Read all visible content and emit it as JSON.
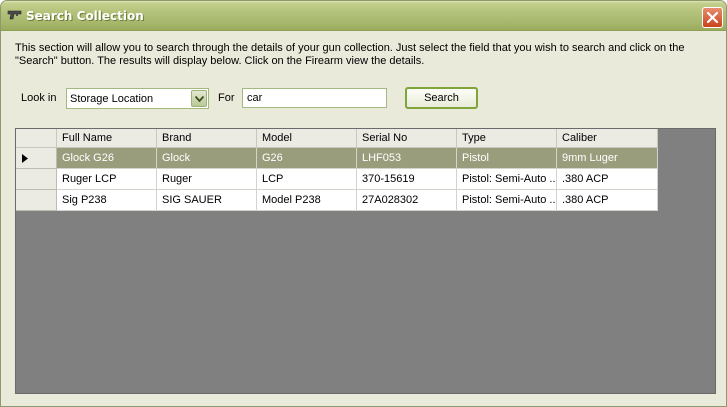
{
  "window": {
    "title": "Search Collection",
    "icon": "gun-icon"
  },
  "description": "This section will allow you to search through the details of your gun collection.  Just select the field that you wish to search and click on the \"Search\" button.  The results will display below.  Click on the Firearm view the details.",
  "search": {
    "look_in_label": "Look in",
    "look_in_value": "Storage Location",
    "for_label": "For",
    "query": "car",
    "button_label": "Search"
  },
  "grid": {
    "columns": [
      "Full Name",
      "Brand",
      "Model",
      "Serial No",
      "Type",
      "Caliber"
    ],
    "rows": [
      {
        "full_name": "Glock G26",
        "brand": "Glock",
        "model": "G26",
        "serial": "LHF053",
        "type": "Pistol",
        "caliber": "9mm Luger",
        "selected": true
      },
      {
        "full_name": "Ruger LCP",
        "brand": "Ruger",
        "model": "LCP",
        "serial": "370-15619",
        "type": "Pistol: Semi-Auto ...",
        "caliber": ".380 ACP",
        "selected": false
      },
      {
        "full_name": "Sig P238",
        "brand": "SIG SAUER",
        "model": "Model P238",
        "serial": "27A028302",
        "type": "Pistol: Semi-Auto ...",
        "caliber": ".380 ACP",
        "selected": false
      }
    ]
  },
  "colors": {
    "titlebar": "#a7b76c",
    "selected_row": "#999d7c",
    "grid_background": "#808080",
    "close_button": "#c8431c"
  }
}
